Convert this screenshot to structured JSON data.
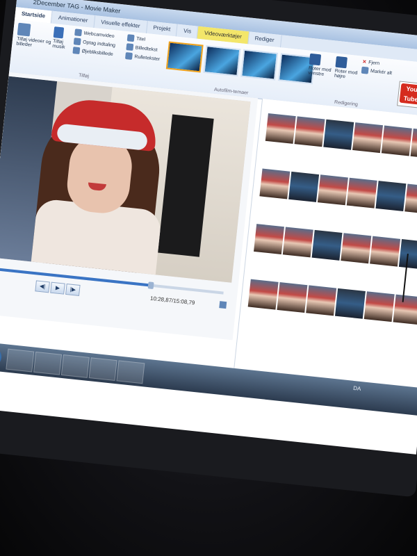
{
  "window": {
    "title": "2December TAG - Movie Maker"
  },
  "tabs": [
    {
      "label": "Startside",
      "active": true
    },
    {
      "label": "Animationer"
    },
    {
      "label": "Visuelle effekter"
    },
    {
      "label": "Projekt"
    },
    {
      "label": "Vis"
    },
    {
      "label": "Videoværktøjer",
      "contextual": true
    },
    {
      "label": "Rediger"
    }
  ],
  "ribbon": {
    "add_videos": "Tilføj videoer og billeder",
    "add_music": "Tilføj musik",
    "webcam": "Webcamvideo",
    "record_narration": "Optag indtaling",
    "snapshot": "Øjebliksbillede",
    "title": "Titel",
    "caption": "Billedtekst",
    "credits": "Rulletekster",
    "add_group": "Tilføj",
    "autofilm_group": "Autofilm-temaer",
    "rotate_left": "Roter mod venstre",
    "rotate_right": "Roter mod højre",
    "remove": "Fjern",
    "select_all": "Markér alt",
    "editing_group": "Redigering",
    "youtube": "You Tube"
  },
  "player": {
    "time": "10:28,87/15:08,79",
    "progress": 0.69
  },
  "taskbar": {
    "lang": "DA"
  }
}
